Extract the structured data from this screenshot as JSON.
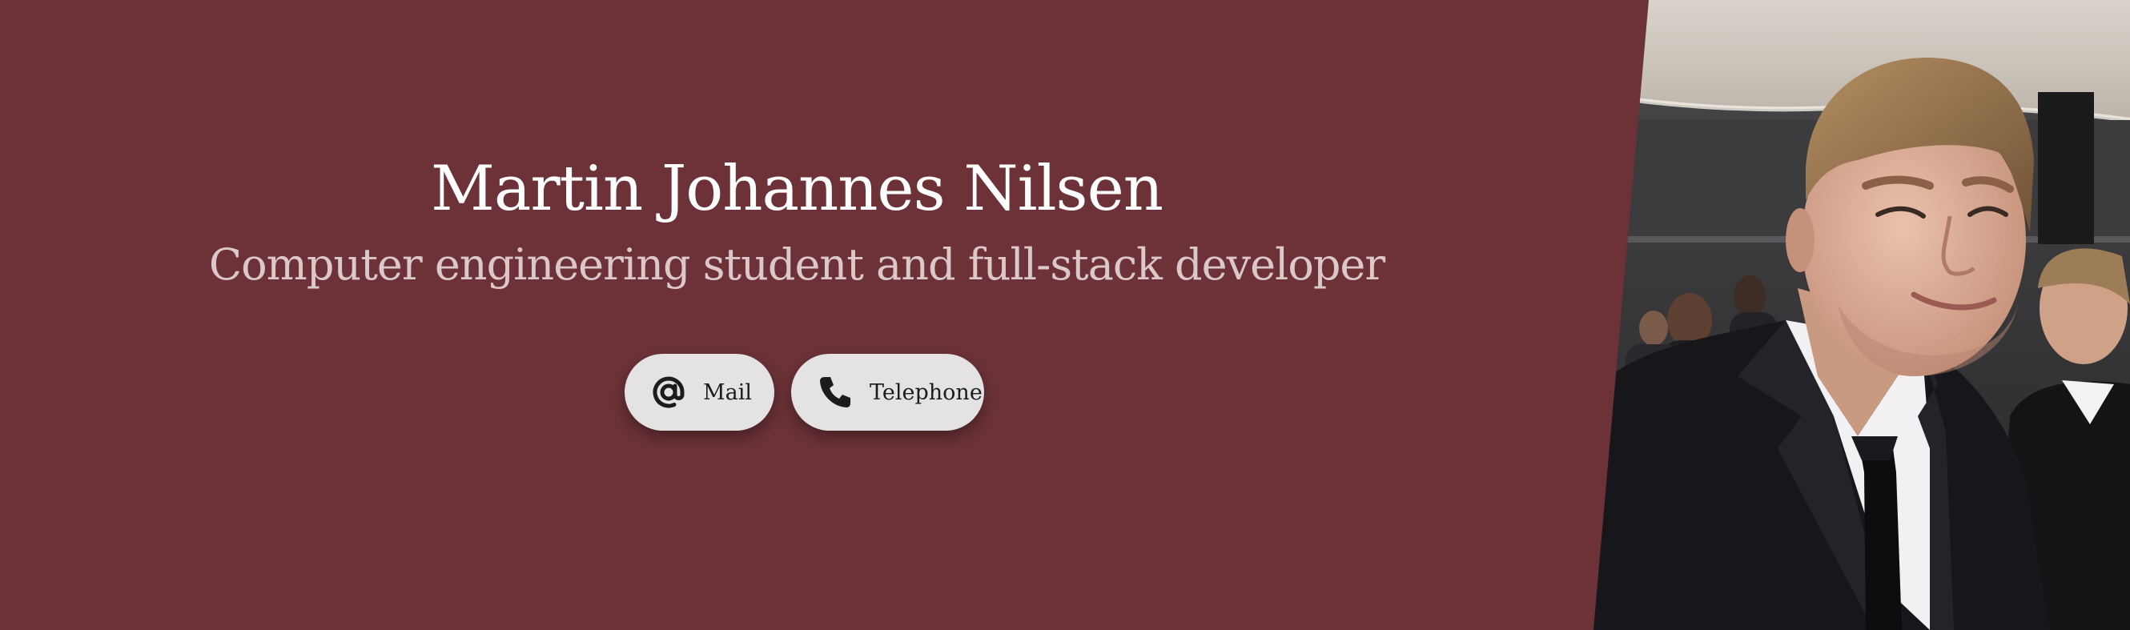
{
  "profile": {
    "name": "Martin Johannes Nilsen",
    "tagline": "Computer engineering student and full-stack developer"
  },
  "contact": {
    "mail_label": "Mail",
    "mail_icon": "at-icon",
    "telephone_label": "Telephone",
    "telephone_icon": "phone-icon"
  },
  "colors": {
    "background": "#6c3238",
    "button": "#e4e2e2",
    "title": "#ffffff",
    "tagline": "#dcc7c9"
  }
}
